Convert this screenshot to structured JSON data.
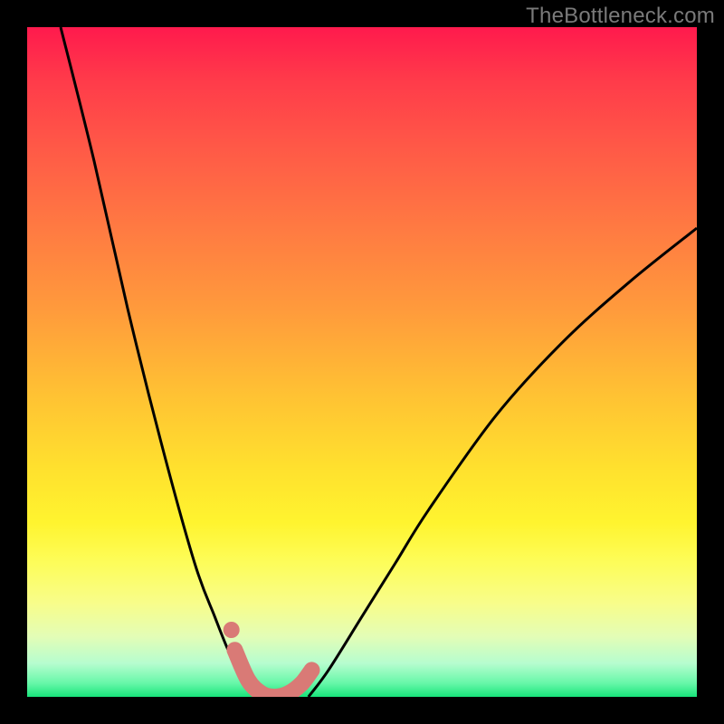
{
  "watermark": "TheBottleneck.com",
  "chart_data": {
    "type": "line",
    "title": "",
    "xlabel": "",
    "ylabel": "",
    "xlim": [
      0,
      100
    ],
    "ylim": [
      0,
      100
    ],
    "series": [
      {
        "name": "left-curve",
        "x": [
          5,
          10,
          15,
          20,
          25,
          28,
          30,
          32,
          33.5,
          35
        ],
        "y": [
          100,
          80,
          58,
          38,
          20,
          12,
          7,
          3,
          1,
          0
        ]
      },
      {
        "name": "right-curve",
        "x": [
          42,
          45,
          50,
          55,
          60,
          70,
          80,
          90,
          100
        ],
        "y": [
          0,
          4,
          12,
          20,
          28,
          42,
          53,
          62,
          70
        ]
      },
      {
        "name": "valley-highlight",
        "x": [
          31,
          33,
          35,
          37,
          39,
          41,
          42.5
        ],
        "y": [
          7,
          2.5,
          0.5,
          0,
          0.5,
          2,
          4
        ]
      },
      {
        "name": "left-dot",
        "x": [
          30.5
        ],
        "y": [
          10
        ]
      }
    ],
    "colors": {
      "curve": "#000000",
      "highlight": "#d97a76",
      "background_top": "#ff1a4d",
      "background_bottom": "#18e47a"
    }
  }
}
